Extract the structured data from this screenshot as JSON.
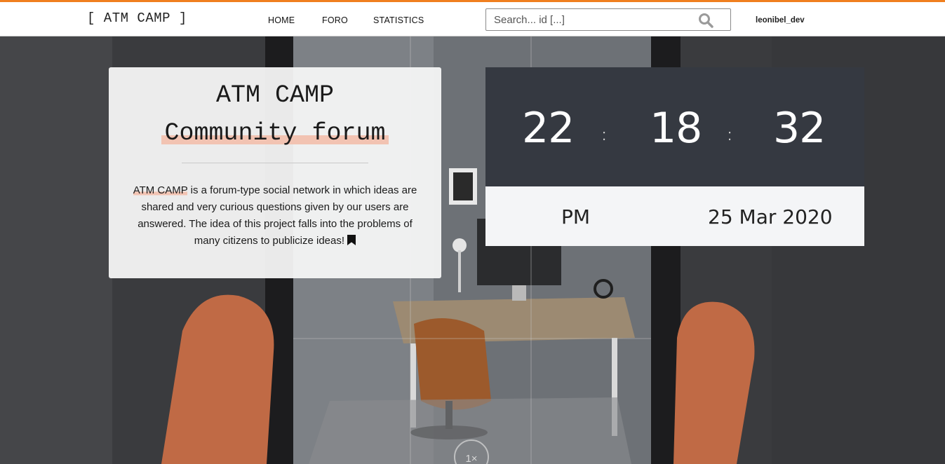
{
  "header": {
    "brand": "[ ATM CAMP ]",
    "nav": [
      {
        "label": "HOME"
      },
      {
        "label": "FORO"
      },
      {
        "label": "STATISTICS"
      }
    ],
    "search": {
      "placeholder": "Search... id [...]",
      "value": ""
    },
    "username": "leonibel_dev",
    "accent_color": "#f07f1f"
  },
  "intro": {
    "title": "ATM CAMP",
    "subtitle": "Community forum",
    "description_highlight": "ATM CAMP",
    "description_rest": " is a forum-type social network in which ideas are shared and very curious questions given by our users are answered. The idea of this project falls into the problems of many citizens to publicize ideas!",
    "highlight_color": "#f2c3b2"
  },
  "clock": {
    "hours": "22",
    "minutes": "18",
    "seconds": "32",
    "separator": ":",
    "ampm": "PM",
    "date": "25 Mar 2020"
  },
  "background": {
    "overlay_text": "1×"
  }
}
